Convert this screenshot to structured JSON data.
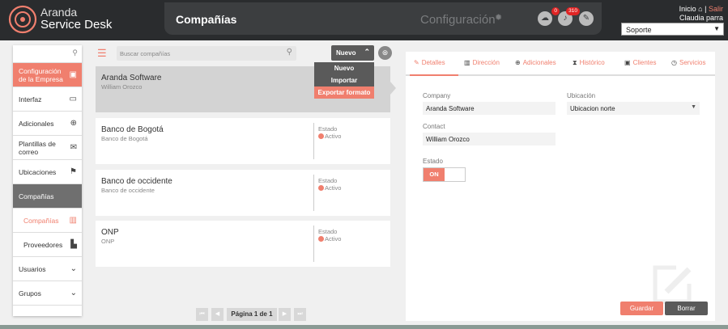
{
  "header": {
    "brand_line1": "Aranda",
    "brand_line2": "Service Desk",
    "page_title": "Compañías",
    "config_label": "Configuración",
    "badges": {
      "cloud": "0",
      "bell": "310"
    },
    "inicio": "Inicio",
    "separator": "|",
    "salir": "Salir",
    "user_name": "Claudia parra",
    "project": "Soporte"
  },
  "sidebar": {
    "items": [
      {
        "label": "Configuración de la Empresa",
        "icon": "building-gear-icon"
      },
      {
        "label": "Interfaz",
        "icon": "monitor-icon"
      },
      {
        "label": "Adicionales",
        "icon": "plus-circle-icon"
      },
      {
        "label": "Plantillas de correo",
        "icon": "mail-icon"
      },
      {
        "label": "Ubicaciones",
        "icon": "signpost-icon"
      },
      {
        "label": "Compañías",
        "icon": ""
      },
      {
        "label": "Compañías",
        "icon": "office-building-icon"
      },
      {
        "label": "Proveedores",
        "icon": "factory-icon"
      },
      {
        "label": "Usuarios",
        "icon": "chevron-down-icon"
      },
      {
        "label": "Grupos",
        "icon": "chevron-down-icon"
      }
    ]
  },
  "list": {
    "search_placeholder": "Buscar compañías",
    "new_button": "Nuevo",
    "dropdown": [
      "Nuevo",
      "Importar",
      "Exportar formato"
    ],
    "estado_label": "Estado",
    "items": [
      {
        "name": "Aranda Software",
        "sub": "William Orozco",
        "status": ""
      },
      {
        "name": "Banco de Bogotá",
        "sub": "Banco de Bogotá",
        "status": "Activo"
      },
      {
        "name": "Banco de occidente",
        "sub": "Banco de occidente",
        "status": "Activo"
      },
      {
        "name": "ONP",
        "sub": "ONP",
        "status": "Activo"
      }
    ],
    "pager": "Página 1 de 1"
  },
  "detail": {
    "tabs": [
      "Detalles",
      "Dirección",
      "Adicionales",
      "Histórico",
      "Clientes",
      "Servicios"
    ],
    "company_label": "Company",
    "company_value": "Aranda Software",
    "ubicacion_label": "Ubicación",
    "ubicacion_value": "Ubicacion norte",
    "contact_label": "Contact",
    "contact_value": "William Orozco",
    "estado_label": "Estado",
    "estado_toggle": "ON",
    "save_button": "Guardar",
    "delete_button": "Borrar"
  },
  "colors": {
    "accent": "#f07f6e",
    "header_bg": "#2a2c2e",
    "dark_button": "#5a5a5a"
  }
}
